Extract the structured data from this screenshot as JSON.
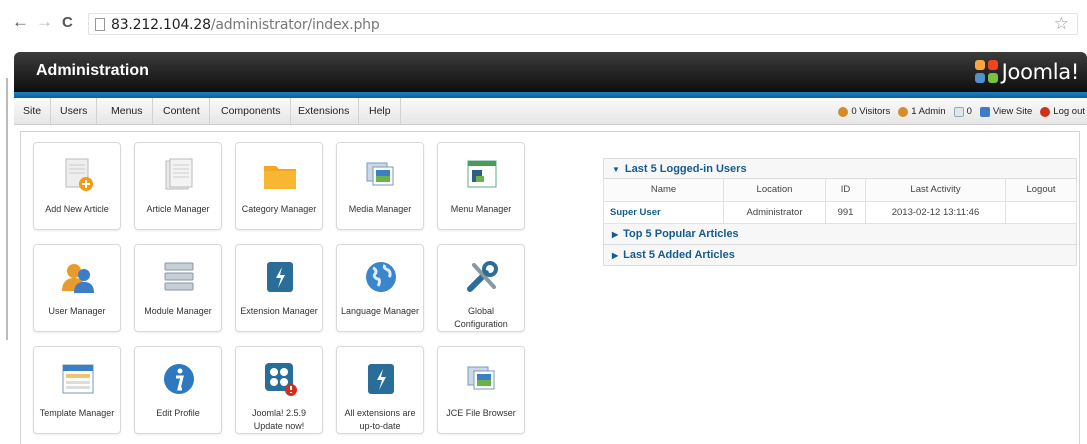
{
  "browser": {
    "url_host": "83.212.104.28",
    "url_path": "/administrator/index.php",
    "back_icon": "←",
    "forward_icon": "→",
    "reload_icon": "C",
    "star_icon": "☆"
  },
  "header": {
    "title": "Administration",
    "logo_text": "Joomla!"
  },
  "menu": [
    "Site",
    "Users",
    "Menus",
    "Content",
    "Components",
    "Extensions",
    "Help"
  ],
  "status": {
    "visitors": "0 Visitors",
    "admins": "1 Admin",
    "messages": "0",
    "view_site": "View Site",
    "logout": "Log out"
  },
  "quickicons": [
    {
      "label": "Add New Article",
      "icon": "add-article-icon"
    },
    {
      "label": "Article Manager",
      "icon": "article-icon"
    },
    {
      "label": "Category Manager",
      "icon": "folder-icon"
    },
    {
      "label": "Media Manager",
      "icon": "media-icon"
    },
    {
      "label": "Menu Manager",
      "icon": "menu-icon"
    },
    {
      "label": "User Manager",
      "icon": "user-icon"
    },
    {
      "label": "Module Manager",
      "icon": "module-icon"
    },
    {
      "label": "Extension Manager",
      "icon": "extension-icon"
    },
    {
      "label": "Language Manager",
      "icon": "globe-icon"
    },
    {
      "label": "Global Configuration",
      "icon": "config-icon"
    },
    {
      "label": "Template Manager",
      "icon": "template-icon"
    },
    {
      "label": "Edit Profile",
      "icon": "info-icon"
    },
    {
      "label": "Joomla! 2.5.9 Update now!",
      "icon": "joomla-update-icon"
    },
    {
      "label": "All extensions are up-to-date",
      "icon": "extension-icon"
    },
    {
      "label": "JCE File Browser",
      "icon": "media-icon"
    }
  ],
  "panels": {
    "logged": {
      "title": "Last 5 Logged-in Users",
      "columns": [
        "Name",
        "Location",
        "ID",
        "Last Activity",
        "Logout"
      ],
      "rows": [
        {
          "name": "Super User",
          "location": "Administrator",
          "id": "991",
          "last_activity": "2013-02-12 13:11:46",
          "logout": ""
        }
      ]
    },
    "popular": {
      "title": "Top 5 Popular Articles"
    },
    "added": {
      "title": "Last 5 Added Articles"
    }
  },
  "colors": {
    "accent": "#135c8f",
    "header_bg": "#1a1a1a",
    "strip": "#1f7fbf",
    "folder": "#f5a623"
  }
}
